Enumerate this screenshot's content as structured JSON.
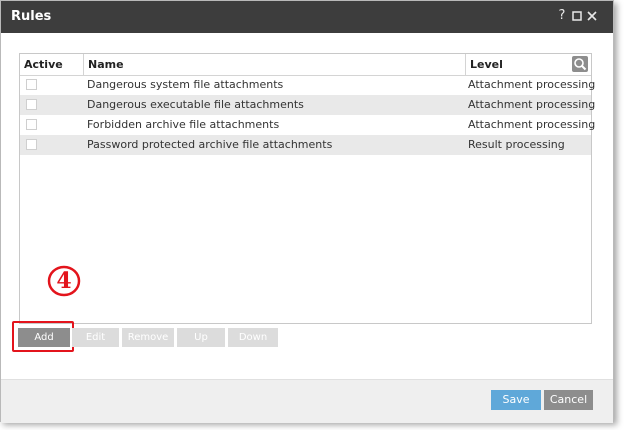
{
  "window": {
    "title": "Rules",
    "help_icon": "question-mark-icon",
    "maximize_icon": "maximize-icon",
    "close_icon": "close-icon"
  },
  "table": {
    "headers": {
      "active": "Active",
      "name": "Name",
      "level": "Level"
    },
    "search_icon": "search-icon",
    "rows": [
      {
        "active": false,
        "name": "Dangerous system file attachments",
        "level": "Attachment processing"
      },
      {
        "active": false,
        "name": "Dangerous executable file attachments",
        "level": "Attachment processing"
      },
      {
        "active": false,
        "name": "Forbidden archive file attachments",
        "level": "Attachment processing"
      },
      {
        "active": false,
        "name": "Password protected archive file attachments",
        "level": "Result processing"
      }
    ]
  },
  "toolbar": {
    "add": "Add",
    "edit": "Edit",
    "remove": "Remove",
    "up": "Up",
    "down": "Down"
  },
  "annotation": {
    "step": "4",
    "color": "#e3141c"
  },
  "footer": {
    "save": "Save",
    "cancel": "Cancel"
  },
  "colors": {
    "titlebar": "#3d3d3d",
    "save": "#5fa8d9",
    "cancel": "#8d8d8d",
    "enabled_button": "#8d8d8d",
    "disabled_button": "#dcdcdc"
  }
}
